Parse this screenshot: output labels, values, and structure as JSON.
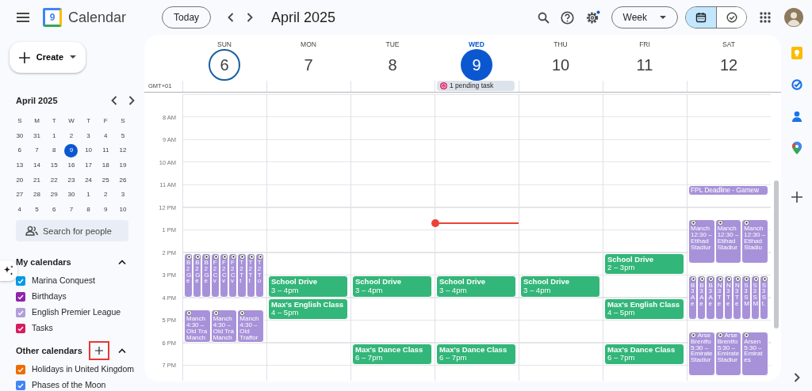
{
  "app": {
    "title": "Calendar",
    "logo_day": "9"
  },
  "toolbar": {
    "today": "Today",
    "period": "April 2025",
    "view": "Week",
    "settings_notification": true,
    "view_toggle": [
      {
        "kind": "calendar",
        "selected": true
      },
      {
        "kind": "tasks",
        "selected": false
      }
    ]
  },
  "create": {
    "label": "Create"
  },
  "mini_calendar": {
    "title": "April 2025",
    "weekdays": [
      "S",
      "M",
      "T",
      "W",
      "T",
      "F",
      "S"
    ],
    "weeks": [
      [
        {
          "d": "30",
          "selected": false
        },
        {
          "d": "31",
          "selected": false
        },
        {
          "d": "1",
          "selected": false
        },
        {
          "d": "2",
          "selected": false
        },
        {
          "d": "3",
          "selected": false
        },
        {
          "d": "4",
          "selected": false
        },
        {
          "d": "5",
          "selected": false
        }
      ],
      [
        {
          "d": "6",
          "selected": false
        },
        {
          "d": "7",
          "selected": false
        },
        {
          "d": "8",
          "selected": false
        },
        {
          "d": "9",
          "selected": true
        },
        {
          "d": "10",
          "selected": false
        },
        {
          "d": "11",
          "selected": false
        },
        {
          "d": "12",
          "selected": false
        }
      ],
      [
        {
          "d": "13",
          "selected": false
        },
        {
          "d": "14",
          "selected": false
        },
        {
          "d": "15",
          "selected": false
        },
        {
          "d": "16",
          "selected": false
        },
        {
          "d": "17",
          "selected": false
        },
        {
          "d": "18",
          "selected": false
        },
        {
          "d": "19",
          "selected": false
        }
      ],
      [
        {
          "d": "20",
          "selected": false
        },
        {
          "d": "21",
          "selected": false
        },
        {
          "d": "22",
          "selected": false
        },
        {
          "d": "23",
          "selected": false
        },
        {
          "d": "24",
          "selected": false
        },
        {
          "d": "25",
          "selected": false
        },
        {
          "d": "26",
          "selected": false
        }
      ],
      [
        {
          "d": "27",
          "selected": false
        },
        {
          "d": "28",
          "selected": false
        },
        {
          "d": "29",
          "selected": false
        },
        {
          "d": "30",
          "selected": false
        },
        {
          "d": "1",
          "selected": false
        },
        {
          "d": "2",
          "selected": false
        },
        {
          "d": "3",
          "selected": false
        }
      ],
      [
        {
          "d": "4",
          "selected": false
        },
        {
          "d": "5",
          "selected": false
        },
        {
          "d": "6",
          "selected": false
        },
        {
          "d": "7",
          "selected": false
        },
        {
          "d": "8",
          "selected": false
        },
        {
          "d": "9",
          "selected": false
        },
        {
          "d": "10",
          "selected": false
        }
      ]
    ]
  },
  "search_people": {
    "placeholder": "Search for people"
  },
  "my_calendars": {
    "title": "My calendars",
    "expanded": true,
    "items": [
      {
        "label": "Marina Conquest",
        "checked": true,
        "color": "#039be5"
      },
      {
        "label": "Birthdays",
        "checked": true,
        "color": "#8e24aa"
      },
      {
        "label": "English Premier League",
        "checked": true,
        "color": "#b39ddb"
      },
      {
        "label": "Tasks",
        "checked": true,
        "color": "#d81b60"
      }
    ]
  },
  "other_calendars": {
    "title": "Other calendars",
    "expanded": true,
    "add_highlighted": true,
    "items": [
      {
        "label": "Holidays in United Kingdom",
        "checked": true,
        "color": "#ef6c00"
      },
      {
        "label": "Phases of the Moon",
        "checked": true,
        "color": "#4285f4"
      }
    ]
  },
  "week": {
    "timezone": "GMT+01",
    "hours": [
      "8 AM",
      "9 AM",
      "10 AM",
      "11 AM",
      "12 PM",
      "1 PM",
      "2 PM",
      "3 PM",
      "4 PM",
      "5 PM",
      "6 PM",
      "7 PM"
    ],
    "days": [
      {
        "name": "SUN",
        "date": "6",
        "today": false,
        "selected": true,
        "events": [
          {
            "kind": "match",
            "color": "#a792d9",
            "lines": [
              "B",
              "2",
              "G",
              "e"
            ]
          },
          {
            "kind": "match",
            "color": "#a792d9",
            "lines": [
              "B",
              "2",
              "G",
              "e"
            ]
          },
          {
            "kind": "match",
            "color": "#a792d9",
            "lines": [
              "B",
              "2",
              "G",
              "e"
            ]
          },
          {
            "kind": "match",
            "color": "#a792d9",
            "lines": [
              "F",
              "2",
              "C",
              "v"
            ]
          },
          {
            "kind": "match",
            "color": "#a792d9",
            "lines": [
              "F",
              "2",
              "C",
              "v"
            ]
          },
          {
            "kind": "match",
            "color": "#a792d9",
            "lines": [
              "F",
              "2",
              "C",
              "v"
            ]
          },
          {
            "kind": "match",
            "color": "#a792d9",
            "lines": [
              "T",
              "2",
              "T",
              "t"
            ]
          },
          {
            "kind": "match",
            "color": "#a792d9",
            "lines": [
              "T",
              "2",
              "T",
              "t"
            ]
          },
          {
            "kind": "match",
            "color": "#a792d9",
            "lines": [
              "T",
              "2",
              "T",
              "o"
            ]
          },
          {
            "kind": "match",
            "color": "#a792d9",
            "lines": [
              "Manch",
              "4:30 –",
              "Old Tra",
              "Manch"
            ]
          },
          {
            "kind": "match",
            "color": "#a792d9",
            "lines": [
              "Manch",
              "4:30 –",
              "Old Tra",
              "Manch"
            ]
          },
          {
            "kind": "match",
            "color": "#a792d9",
            "lines": [
              "Manch",
              "4:30 –",
              "Old",
              "Traffor"
            ]
          }
        ]
      },
      {
        "name": "MON",
        "date": "7",
        "today": false,
        "selected": false,
        "events": [
          {
            "kind": "plain",
            "color": "#33b679",
            "lines": [
              "School Drive",
              "3 – 4pm"
            ]
          },
          {
            "kind": "plain",
            "color": "#33b679",
            "lines": [
              "Max's English Class",
              "4 – 5pm"
            ]
          }
        ]
      },
      {
        "name": "TUE",
        "date": "8",
        "today": false,
        "selected": false,
        "events": [
          {
            "kind": "plain",
            "color": "#33b679",
            "lines": [
              "School Drive",
              "3 – 4pm"
            ]
          },
          {
            "kind": "plain",
            "color": "#33b679",
            "lines": [
              "Max's Dance Class",
              "6 – 7pm"
            ]
          }
        ]
      },
      {
        "name": "WED",
        "date": "9",
        "today": true,
        "selected": false,
        "tasks": "1 pending task",
        "current_time": true,
        "events": [
          {
            "kind": "plain",
            "color": "#33b679",
            "lines": [
              "School Drive",
              "3 – 4pm"
            ]
          },
          {
            "kind": "plain",
            "color": "#33b679",
            "lines": [
              "Max's Dance Class",
              "6 – 7pm"
            ]
          }
        ]
      },
      {
        "name": "THU",
        "date": "10",
        "today": false,
        "selected": false,
        "events": [
          {
            "kind": "plain",
            "color": "#33b679",
            "lines": [
              "School Drive",
              "3 – 4pm"
            ]
          }
        ]
      },
      {
        "name": "FRI",
        "date": "11",
        "today": false,
        "selected": false,
        "events": [
          {
            "kind": "plain",
            "color": "#33b679",
            "lines": [
              "School Drive",
              "2 – 3pm"
            ]
          },
          {
            "kind": "plain",
            "color": "#33b679",
            "lines": [
              "Max's English Class",
              "4 – 5pm"
            ]
          },
          {
            "kind": "plain",
            "color": "#33b679",
            "lines": [
              "Max's Dance Class",
              "6 – 7pm"
            ]
          }
        ]
      },
      {
        "name": "SAT",
        "date": "12",
        "today": false,
        "selected": false,
        "events": [
          {
            "kind": "short",
            "color": "#a792d9",
            "lines": [
              "FPL Deadline - Gamew"
            ]
          },
          {
            "kind": "match",
            "color": "#a792d9",
            "lines": [
              "Manch",
              "12:30 –",
              "Etihad",
              "Stadiur"
            ]
          },
          {
            "kind": "match",
            "color": "#a792d9",
            "lines": [
              "Manch",
              "12:30 –",
              "Etihad",
              "Stadiur"
            ]
          },
          {
            "kind": "match",
            "color": "#a792d9",
            "lines": [
              "Manch",
              "12:30 –",
              "Etihad",
              "Stadiu"
            ]
          },
          {
            "kind": "match",
            "color": "#a792d9",
            "lines": [
              "B",
              "3",
              "A",
              "e"
            ]
          },
          {
            "kind": "match",
            "color": "#a792d9",
            "lines": [
              "B",
              "3",
              "A",
              "e"
            ]
          },
          {
            "kind": "match",
            "color": "#a792d9",
            "lines": [
              "B",
              "3",
              "A",
              "e"
            ]
          },
          {
            "kind": "match",
            "color": "#a792d9",
            "lines": [
              "N",
              "3",
              "T",
              "e"
            ]
          },
          {
            "kind": "match",
            "color": "#a792d9",
            "lines": [
              "N",
              "3",
              "T",
              "e"
            ]
          },
          {
            "kind": "match",
            "color": "#a792d9",
            "lines": [
              "N",
              "3",
              "T",
              "e"
            ]
          },
          {
            "kind": "match",
            "color": "#a792d9",
            "lines": [
              "S",
              "3",
              "S",
              "M"
            ]
          },
          {
            "kind": "match",
            "color": "#a792d9",
            "lines": [
              "S",
              "3",
              "S",
              "M"
            ]
          },
          {
            "kind": "match",
            "color": "#a792d9",
            "lines": [
              "S",
              "3",
              "S",
              "t."
            ]
          },
          {
            "kind": "match_inline",
            "color": "#a792d9",
            "lines": [
              "Arse",
              "Brentfo",
              "5:30 –",
              "Emirate",
              "Stadiur"
            ]
          },
          {
            "kind": "match_inline",
            "color": "#a792d9",
            "lines": [
              "Arse",
              "Brentfo",
              "5:30 –",
              "Emirate",
              "Stadiur"
            ]
          },
          {
            "kind": "match",
            "color": "#a792d9",
            "lines": [
              "Arsen",
              "5:30 –",
              "Emirat",
              "es"
            ]
          }
        ]
      }
    ]
  }
}
